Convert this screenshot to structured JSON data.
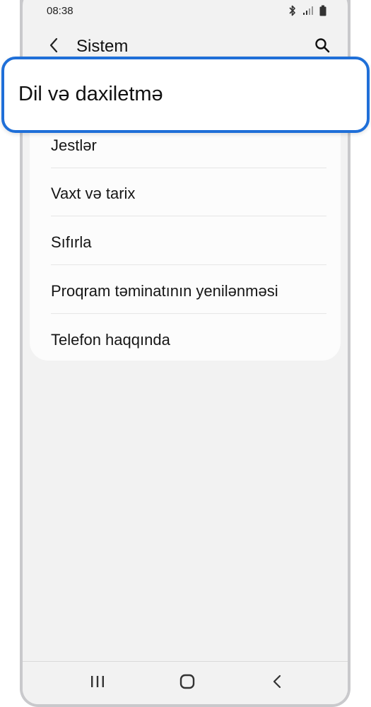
{
  "status_bar": {
    "time": "08:38",
    "icons": [
      "bluetooth-icon",
      "signal-icon",
      "battery-icon"
    ]
  },
  "app_bar": {
    "back_icon": "chevron-left-icon",
    "title": "Sistem",
    "search_icon": "search-icon"
  },
  "highlighted_item": {
    "label": "Dil və daxiletmə"
  },
  "list": {
    "items": [
      {
        "label": "Jestlər"
      },
      {
        "label": "Vaxt və tarix"
      },
      {
        "label": "Sıfırla"
      },
      {
        "label": "Proqram təminatının yenilənməsi"
      },
      {
        "label": "Telefon haqqında"
      }
    ]
  },
  "nav_bar": {
    "icons": [
      "recent-apps-icon",
      "home-icon",
      "back-icon"
    ]
  },
  "colors": {
    "highlight_border": "#1f6fd8",
    "background": "#f2f2f2",
    "card": "#fcfcfc"
  }
}
